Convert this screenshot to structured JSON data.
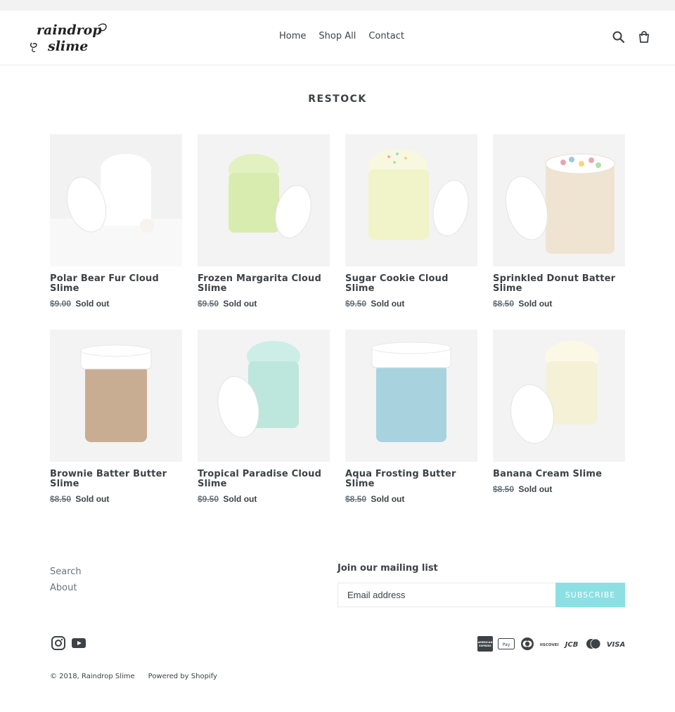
{
  "brand": {
    "logo_line1": "raindrop",
    "logo_line2": "slime"
  },
  "nav": {
    "items": [
      {
        "label": "Home"
      },
      {
        "label": "Shop All"
      },
      {
        "label": "Contact"
      }
    ]
  },
  "header_icons": [
    "search-icon",
    "cart-icon"
  ],
  "page": {
    "title": "RESTOCK"
  },
  "products": [
    {
      "title": "Polar Bear Fur Cloud Slime",
      "price": "$9.00",
      "status": "Sold out",
      "color": "#f4f4f4"
    },
    {
      "title": "Frozen Margarita Cloud Slime",
      "price": "$9.50",
      "status": "Sold out",
      "color": "#d9ecb0"
    },
    {
      "title": "Sugar Cookie Cloud Slime",
      "price": "$9.50",
      "status": "Sold out",
      "color": "#f1f3c9"
    },
    {
      "title": "Sprinkled Donut Batter Slime",
      "price": "$8.50",
      "status": "Sold out",
      "color": "#efe4d2"
    },
    {
      "title": "Brownie Batter Butter Slime",
      "price": "$8.50",
      "status": "Sold out",
      "color": "#c9ad92"
    },
    {
      "title": "Tropical Paradise Cloud Slime",
      "price": "$9.50",
      "status": "Sold out",
      "color": "#bde7dd"
    },
    {
      "title": "Aqua Frosting Butter Slime",
      "price": "$8.50",
      "status": "Sold out",
      "color": "#a8d3de"
    },
    {
      "title": "Banana Cream Slime",
      "price": "$8.50",
      "status": "Sold out",
      "color": "#f4f1d6"
    }
  ],
  "footer": {
    "links": [
      {
        "label": "Search"
      },
      {
        "label": "About"
      }
    ],
    "mailing": {
      "heading": "Join our mailing list",
      "placeholder": "Email address",
      "button": "SUBSCRIBE"
    },
    "social": [
      "instagram-icon",
      "youtube-icon"
    ],
    "payments": [
      "american-express-icon",
      "apple-pay-icon",
      "diners-club-icon",
      "discover-icon",
      "jcb-icon",
      "master-icon",
      "visa-icon"
    ],
    "payment_labels": {
      "discover": "DISCOVER",
      "jcb": "JCB",
      "visa": "VISA",
      "amex": "AMERICAN EXPRESS"
    },
    "copyright": "© 2018, Raindrop Slime",
    "powered": "Powered by Shopify"
  },
  "colors": {
    "text": "#3d4246",
    "muted": "#69727b",
    "accent": "#8be0e3",
    "topbar": "#f2f2f2"
  }
}
